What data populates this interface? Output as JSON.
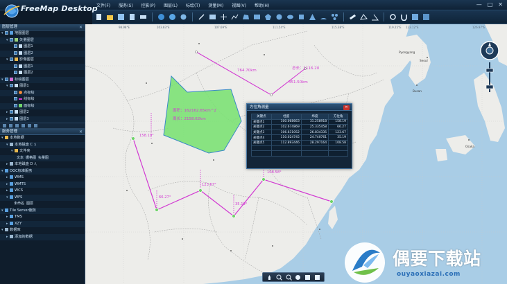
{
  "app": {
    "title": "FreeMap Desktop"
  },
  "menu": [
    "文件(F)",
    "服务(S)",
    "控影(P)",
    "图层(L)",
    "标绘(T)",
    "测量(M)",
    "视图(V)",
    "帮助(H)"
  ],
  "window_controls": [
    "—",
    "□",
    "✕"
  ],
  "sidebar": {
    "layers_panel_title": "图层管理",
    "layer_tree": [
      {
        "label": "地图图层",
        "level": 0,
        "checked": true
      },
      {
        "label": "矢量图层",
        "level": 1,
        "checked": true
      },
      {
        "label": "图层1",
        "level": 2,
        "checked": true
      },
      {
        "label": "图层2",
        "level": 2,
        "checked": true
      },
      {
        "label": "影像图层",
        "level": 1,
        "checked": true
      },
      {
        "label": "图层1",
        "level": 2,
        "checked": true
      },
      {
        "label": "图层2",
        "level": 2,
        "checked": true
      },
      {
        "label": "标绘图层",
        "level": 0,
        "checked": true
      },
      {
        "label": "图层1",
        "level": 1,
        "checked": true
      },
      {
        "label": "点标绘",
        "level": 2,
        "checked": true
      },
      {
        "label": "线标绘",
        "level": 2,
        "checked": true
      },
      {
        "label": "面标绘",
        "level": 2,
        "checked": true
      },
      {
        "label": "图层2",
        "level": 1,
        "checked": true
      },
      {
        "label": "图层3",
        "level": 1,
        "checked": true
      }
    ],
    "services_panel_title": "服务管理",
    "service_tree": [
      {
        "label": "本地数据",
        "level": 0
      },
      {
        "label": "本地磁盘 C :\\",
        "level": 1
      },
      {
        "label": "文件夹",
        "level": 2
      },
      {
        "label": "",
        "level": 3,
        "tags": [
          "文本",
          "栅格图",
          "矢量图"
        ]
      },
      {
        "label": "本地磁盘 D :\\",
        "level": 1
      },
      {
        "label": "OGC标准服务",
        "level": 0
      },
      {
        "label": "WMS",
        "level": 1
      },
      {
        "label": "WMTS",
        "level": 1
      },
      {
        "label": "WCS",
        "level": 1
      },
      {
        "label": "WFS",
        "level": 1
      },
      {
        "label": "",
        "level": 2,
        "tags": [
          "未命名",
          "图层"
        ]
      },
      {
        "label": "Tile Server服务",
        "level": 0
      },
      {
        "label": "TMS",
        "level": 1
      },
      {
        "label": "XZY",
        "level": 1
      },
      {
        "label": "数据库",
        "level": 0
      },
      {
        "label": "添加的数据",
        "level": 1
      }
    ]
  },
  "map": {
    "top_coords": [
      "98.98°E",
      "103.83°E",
      "107.69°E",
      "111.54°E",
      "115.38°E",
      "119.25°E",
      "123.12°E",
      "126.97°E"
    ],
    "measurements": {
      "area_label": "面积：162162.65km^2",
      "perimeter_label": "周长：2158.62km",
      "line1_length": "764.70km",
      "line1_total": "总长：1116.20",
      "line1_segment": "351.50km",
      "bearing1": "158.19°",
      "bearing2": "66.27°",
      "bearing3": "123.67°",
      "bearing4": "35.19°",
      "bearing5": "108.58°"
    },
    "place_labels": [
      "Pyongyang",
      "Seoul",
      "Busan",
      "Osaka"
    ]
  },
  "dialog": {
    "title": "方位角测量",
    "headers": [
      "关键点",
      "经度",
      "纬度",
      "方位角"
    ],
    "rows": [
      [
        "关键点1",
        "100.068663",
        "31.258918",
        "158.19"
      ],
      [
        "关键点2",
        "102.674869",
        "25.335458",
        "66.27"
      ],
      [
        "关键点3",
        "106.631052",
        "26.834335",
        "123.67"
      ],
      [
        "关键点4",
        "110.024745",
        "24.740761",
        "35.19"
      ],
      [
        "关键点5",
        "112.893446",
        "28.297164",
        "108.58"
      ]
    ]
  },
  "watermark": {
    "cn": "偶要下载站",
    "en": "ouyaoxiazai.com"
  },
  "colors": {
    "measure": "#d23bd2",
    "polygon_fill": "#76e06f",
    "land": "#ececea",
    "sea": "#a9cde6"
  }
}
